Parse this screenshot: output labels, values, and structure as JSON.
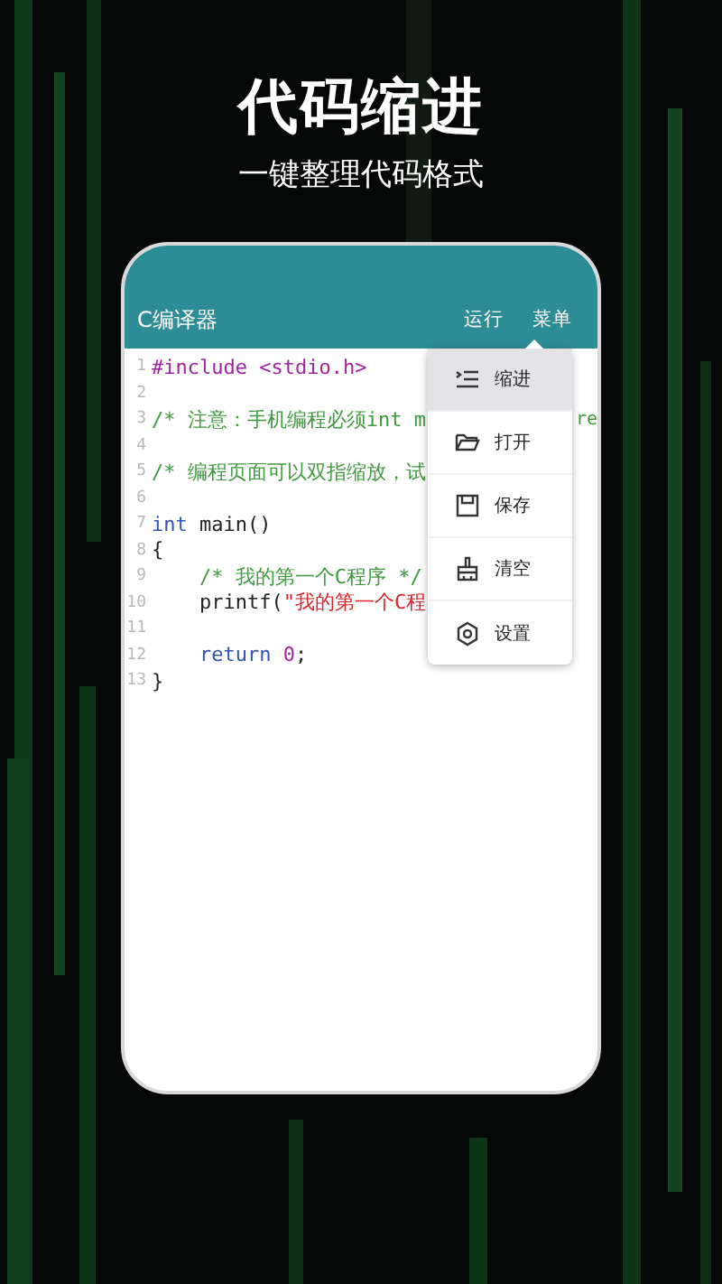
{
  "headline": "代码缩进",
  "subtitle": "一键整理代码格式",
  "app_bar": {
    "title": "C编译器",
    "actions": [
      {
        "label": "运行"
      },
      {
        "label": "菜单"
      }
    ]
  },
  "code_lines": [
    {
      "number": "1",
      "tokens": [
        {
          "text": "#include <stdio.h>",
          "kind": "preprocessor"
        }
      ]
    },
    {
      "number": "2"
    },
    {
      "number": "3",
      "tokens": [
        {
          "text": "/* 注意：手机编程必须int m",
          "kind": "comment"
        }
      ],
      "tail": "re"
    },
    {
      "number": "4"
    },
    {
      "number": "5",
      "tokens": [
        {
          "text": "/* 编程页面可以双指缩放，试",
          "kind": "comment"
        }
      ]
    },
    {
      "number": "6"
    },
    {
      "number": "7",
      "tokens": [
        {
          "text": "int",
          "kind": "keyword"
        },
        {
          "text": " main()",
          "kind": "plain"
        }
      ]
    },
    {
      "number": "8",
      "tokens": [
        {
          "text": "{",
          "kind": "plain"
        }
      ]
    },
    {
      "number": "9",
      "tokens": [
        {
          "text": "    /* 我的第一个C程序 */",
          "kind": "comment"
        }
      ]
    },
    {
      "number": "10",
      "tokens": [
        {
          "text": "    printf(",
          "kind": "plain"
        },
        {
          "text": "\"我的第一个C程",
          "kind": "string"
        }
      ]
    },
    {
      "number": "11"
    },
    {
      "number": "12",
      "tokens": [
        {
          "text": "    return",
          "kind": "keyword"
        },
        {
          "text": " 0",
          "kind": "number"
        },
        {
          "text": ";",
          "kind": "plain"
        }
      ]
    },
    {
      "number": "13",
      "tokens": [
        {
          "text": "}",
          "kind": "plain"
        }
      ]
    }
  ],
  "menu": [
    {
      "label": "缩进",
      "kind": "indent",
      "selected": true
    },
    {
      "label": "打开",
      "kind": "open",
      "selected": false
    },
    {
      "label": "保存",
      "kind": "save",
      "selected": false
    },
    {
      "label": "清空",
      "kind": "clear",
      "selected": false
    },
    {
      "label": "设置",
      "kind": "settings",
      "selected": false
    }
  ]
}
